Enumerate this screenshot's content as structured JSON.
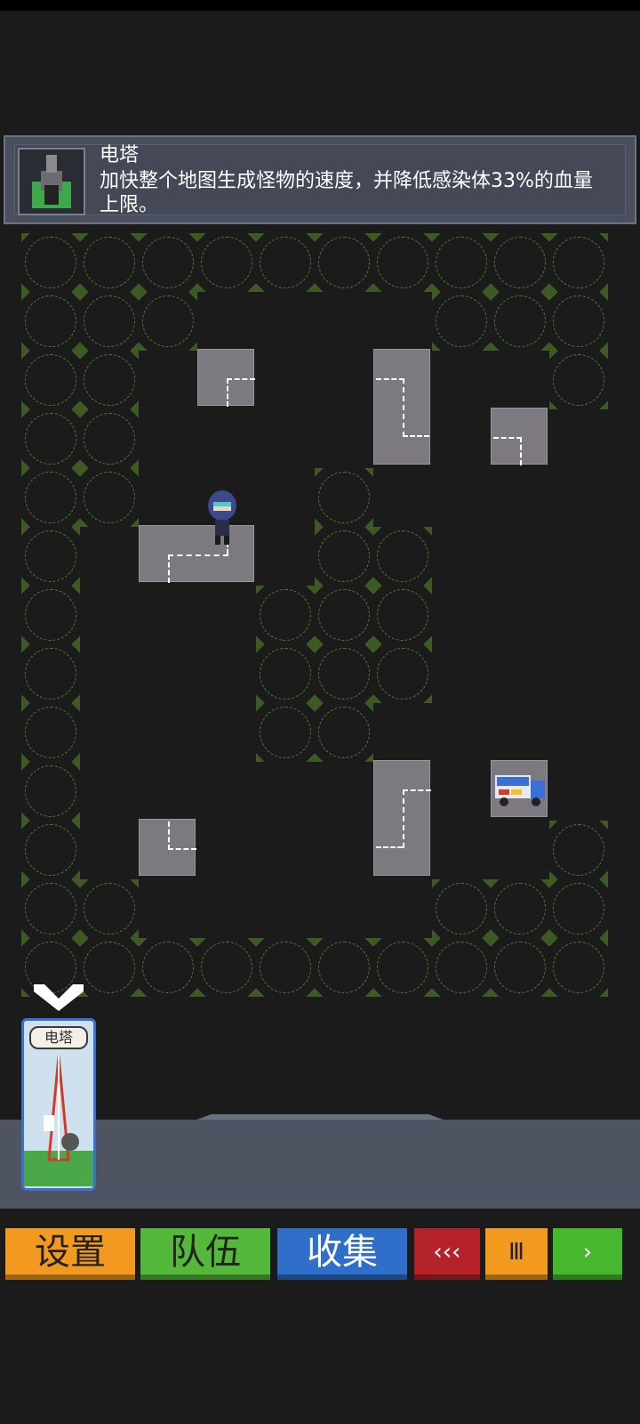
{
  "info": {
    "title": "电塔",
    "description": "加快整个地图生成怪物的速度，并降低感染体33%的血量上限。"
  },
  "card": {
    "label": "电塔"
  },
  "buttons": {
    "settings": "设置",
    "team": "队伍",
    "collect": "收集",
    "rewind": "‹‹‹",
    "pause": "Ⅲ",
    "play": "›"
  },
  "colors": {
    "settings": "#f29a1f",
    "team": "#54b83a",
    "collect": "#2f6fc9",
    "rewind": "#b4232a",
    "pause": "#f29a1f",
    "play": "#47b82e"
  },
  "icons": {
    "info_thumb": "radio-tower-icon",
    "chevron": "chevron-down-icon",
    "player": "player-character",
    "vehicle": "truck-icon"
  }
}
